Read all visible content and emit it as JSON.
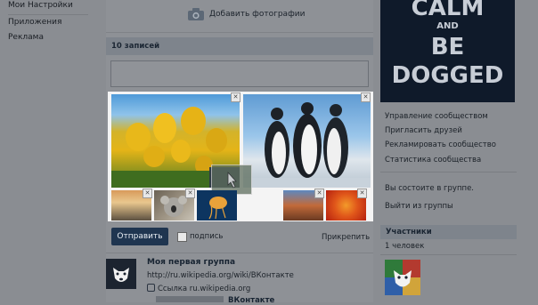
{
  "sidebar": {
    "items": [
      {
        "label": "Мои Настройки"
      },
      {
        "label": "Приложения"
      },
      {
        "label": "Реклама"
      }
    ]
  },
  "composer": {
    "add_photos_label": "Добавить фотографии",
    "posts_count_label": "10 записей",
    "send_label": "Отправить",
    "signature_label": "подпись",
    "attach_label": "Прикрепить"
  },
  "feed": {
    "post_title": "Моя первая группа",
    "post_link": "http://ru.wikipedia.org/wiki/ВКонтакте",
    "post_ref": "Ссылка ru.wikipedia.org",
    "post_ref_title": "ВКонтакте"
  },
  "right": {
    "poster_lines": [
      "CALM",
      "AND",
      "BE",
      "DOGGED"
    ],
    "menu": [
      {
        "label": "Управление сообществом"
      },
      {
        "label": "Пригласить друзей"
      },
      {
        "label": "Рекламировать сообщество"
      },
      {
        "label": "Статистика сообщества"
      }
    ],
    "membership_text": "Вы состоите в группе.",
    "leave_label": "Выйти из группы",
    "members_title": "Участники",
    "members_count": "1 человек"
  },
  "icons": [
    "camera-icon",
    "close-icon",
    "link-icon",
    "dog-logo-icon"
  ],
  "colors": {
    "accent": "#1f3550",
    "header": "#7e848c",
    "poster": "#0f1a2a"
  }
}
